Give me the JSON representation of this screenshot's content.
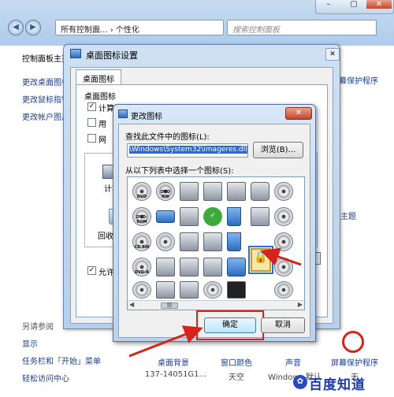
{
  "control_panel": {
    "address": "所有控制面...  › 个性化",
    "search_placeholder": "搜索控制面板",
    "left_links": [
      "控制面板主页",
      "更改桌面图标",
      "更改鼠标指针",
      "更改帐户图片"
    ],
    "see_also_title": "另请参阅",
    "see_also": [
      "显示",
      "任务栏和「开始」菜单",
      "轻松访问中心"
    ],
    "right_link": "幕保护程序",
    "right_link2": "主题",
    "bottom_items": [
      "桌面背景",
      "窗口颜色",
      "声音",
      "屏幕保护程序"
    ],
    "bottom_sub": [
      "137-14051G1...",
      "天空",
      "Windows 默认",
      "无"
    ]
  },
  "desktop_icon_dialog": {
    "title": "桌面图标设置",
    "tab": "桌面图标",
    "group_title": "桌面图标",
    "checkboxes": [
      {
        "label": "计算机",
        "checked": true
      },
      {
        "label": "用",
        "checked": false
      },
      {
        "label": "网",
        "checked": false
      }
    ],
    "preview_labels": [
      "计算",
      "回收站"
    ],
    "allow_label": "允许"
  },
  "change_icon_dialog": {
    "title": "更改图标",
    "close_label": "✕",
    "look_for_label": "查找此文件中的图标(L):",
    "path_value": "\\Windows\\System32\\imageres.dll",
    "browse_label": "浏览(B)...",
    "select_label": "从以下列表中选择一个图标(S):",
    "ok_label": "确定",
    "cancel_label": "取消",
    "icon_labels": {
      "dvd": "DVD",
      "dvdrw": "DVD RW",
      "dvdrom": "DVD-ROM",
      "cdrw": "CD RW",
      "dvdr": "DVD-R"
    }
  },
  "watermark": "百度知道",
  "colors": {
    "highlight": "#d8231a",
    "selection": "#3166c7"
  }
}
